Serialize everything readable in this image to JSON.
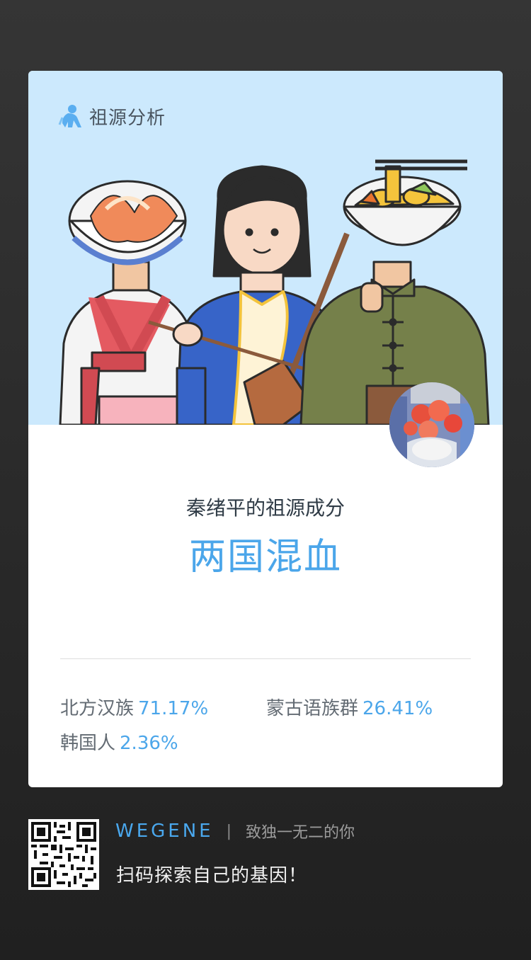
{
  "header": {
    "label": "祖源分析",
    "icon": "monkey-icon"
  },
  "result": {
    "subtitle": "秦绪平的祖源成分",
    "headline": "两国混血"
  },
  "ancestry": [
    {
      "name": "北方汉族",
      "percent": "71.17%"
    },
    {
      "name": "蒙古语族群",
      "percent": "26.41%"
    },
    {
      "name": "韩国人",
      "percent": "2.36%"
    }
  ],
  "footer": {
    "brand": "WEGENE",
    "separator": "|",
    "slogan": "致独一无二的你",
    "cta": "扫码探索自己的基因！"
  },
  "colors": {
    "accent": "#4ba6ea",
    "hero_bg": "#cce9fd",
    "page_bg": "#2b2b2b"
  }
}
